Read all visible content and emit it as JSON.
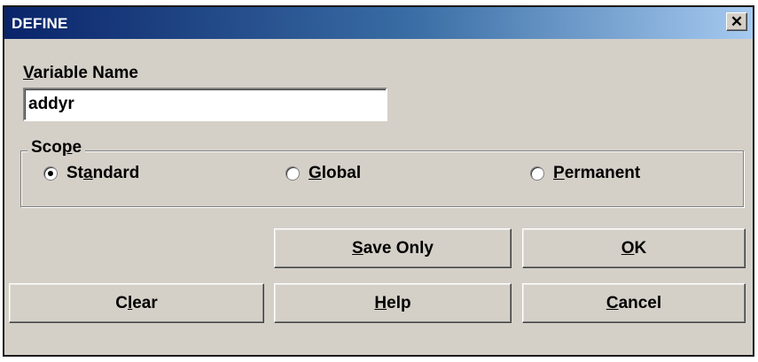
{
  "window": {
    "title": "DEFINE",
    "close_glyph": "✕"
  },
  "variable_name": {
    "label_accel": "V",
    "label_rest": "ariable Name",
    "value": "addyr"
  },
  "scope": {
    "label_pre": "Sco",
    "label_accel": "p",
    "label_post": "e",
    "options": [
      {
        "pre": "St",
        "accel": "a",
        "post": "ndard",
        "checked": true
      },
      {
        "pre": "",
        "accel": "G",
        "post": "lobal",
        "checked": false
      },
      {
        "pre": "",
        "accel": "P",
        "post": "ermanent",
        "checked": false
      }
    ]
  },
  "buttons": {
    "save_only": {
      "pre": "",
      "accel": "S",
      "post": "ave Only"
    },
    "ok": {
      "pre": "",
      "accel": "O",
      "post": "K"
    },
    "clear": {
      "pre": "C",
      "accel": "l",
      "post": "ear"
    },
    "help": {
      "pre": "",
      "accel": "H",
      "post": "elp"
    },
    "cancel": {
      "pre": "",
      "accel": "C",
      "post": "ancel"
    }
  }
}
